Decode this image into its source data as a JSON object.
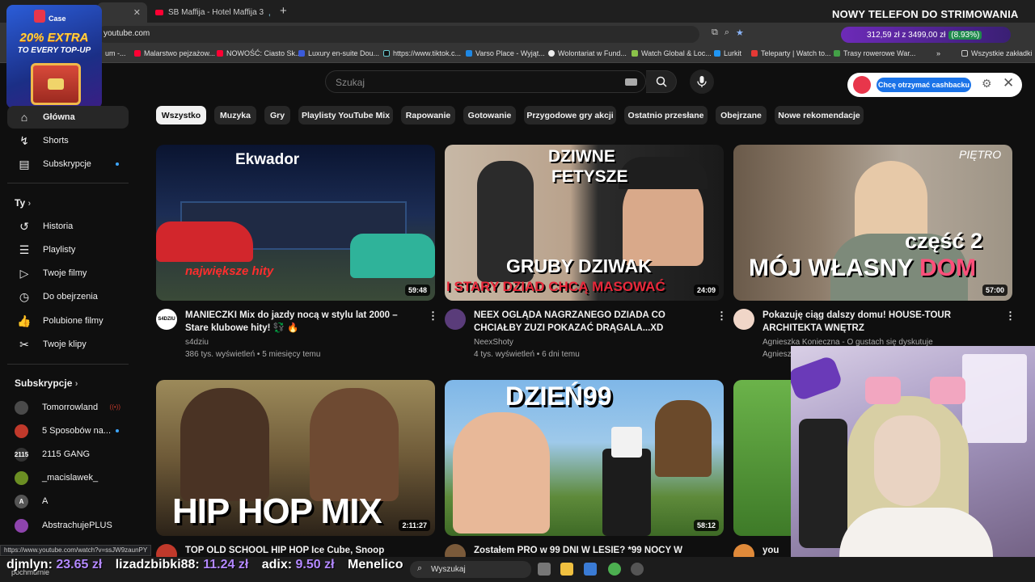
{
  "browser": {
    "tab_active_label": "",
    "tab_second_label": "SB Maffija - Hotel Maffija 3",
    "url": "youtube.com",
    "promo_heading": "NOWY TELEFON DO STRIMOWANIA",
    "wallet_text": "312,59 zł z 3499,00 zł",
    "wallet_pct": "(8.93%)",
    "bookmarks": [
      "um -...",
      "Malarstwo pejzażow...",
      "NOWOŚĆ: Ciasto Sk...",
      "Luxury en-suite Dou...",
      "https://www.tiktok.c...",
      "Varso Place - Wyjąt...",
      "Wolontariat w Fund...",
      "Watch Global & Loc...",
      "Lurkit",
      "Teleparty | Watch to...",
      "Trasy rowerowe War..."
    ],
    "bookmarks_all": "Wszystkie zakładki"
  },
  "casebox": {
    "logo": "Case",
    "extra": "20% EXTRA",
    "sub": "TO EVERY TOP-UP"
  },
  "youtube": {
    "search_placeholder": "Szukaj",
    "cashback_button": "Chcę otrzymać cashbacku",
    "sidebar": {
      "main": [
        {
          "label": "Główna",
          "icon": "home-icon"
        },
        {
          "label": "Shorts",
          "icon": "shorts-icon"
        },
        {
          "label": "Subskrypcje",
          "icon": "subscriptions-icon"
        }
      ],
      "you_heading": "Ty",
      "you_items": [
        {
          "label": "Historia",
          "icon": "history-icon"
        },
        {
          "label": "Playlisty",
          "icon": "playlists-icon"
        },
        {
          "label": "Twoje filmy",
          "icon": "your-videos-icon"
        },
        {
          "label": "Do obejrzenia",
          "icon": "watch-later-icon"
        },
        {
          "label": "Polubione filmy",
          "icon": "liked-icon"
        },
        {
          "label": "Twoje klipy",
          "icon": "clips-icon"
        }
      ],
      "subs_heading": "Subskrypcje",
      "subs": [
        {
          "label": "Tomorrowland",
          "avatar": "",
          "color": "#4a4a4a"
        },
        {
          "label": "5 Sposobów na...",
          "avatar": "",
          "color": "#c0392b"
        },
        {
          "label": "2115 GANG",
          "avatar": "2115",
          "color": "#333333"
        },
        {
          "label": "_macislawek_",
          "avatar": "",
          "color": "#6b8e23"
        },
        {
          "label": "A",
          "avatar": "A",
          "color": "#555555"
        },
        {
          "label": "AbstrachujePLUS",
          "avatar": "",
          "color": "#8e44ad"
        }
      ],
      "partial_label": "pochmurnie"
    },
    "chips": [
      "Wszystko",
      "Muzyka",
      "Gry",
      "Playlisty YouTube Mix",
      "Rapowanie",
      "Gotowanie",
      "Przygodowe gry akcji",
      "Ostatnio przesłane",
      "Obejrzane",
      "Nowe rekomendacje"
    ],
    "videos": [
      {
        "title": "MANIECZKI Mix do jazdy nocą w stylu lat 2000 – Stare klubowe hity! 💱 🔥",
        "channel": "s4dziu",
        "meta": "386 tys. wyświetleń • 5 miesięcy temu",
        "duration": "59:48",
        "overlay": "Ekwador",
        "overlay2": "największe hity",
        "avatar": "S4DZIU"
      },
      {
        "title": "NEEX OGLĄDA NAGRZANEGO DZIADA CO CHCIAŁBY ZUZI POKAZAĆ DRĄGALA...XD",
        "channel": "NeexShoty",
        "meta": "4 tys. wyświetleń • 6 dni temu",
        "duration": "24:09",
        "overlay": "DZIWNE",
        "overlay2": "FETYSZE",
        "overlay3": "GRUBY DZIWAK",
        "overlay4": "I STARY DZIAD CHCĄ MASOWAĆ"
      },
      {
        "title": "Pokazuję ciąg dalszy domu! HOUSE-TOUR ARCHITEKTA WNĘTRZ",
        "channel": "Agnieszka Konieczna - O gustach się dyskutuje",
        "meta": "Agnieszka Konieczna - O gustach się dyskutuje",
        "duration": "57:00",
        "overlay": "PIĘTRO",
        "overlay2": "część 2",
        "overlay3": "MÓJ WŁASNY",
        "overlay4": "DOM"
      },
      {
        "title": "TOP OLD SCHOOL HIP HOP Ice Cube, Snoop",
        "duration": "2:11:27",
        "overlay": "HIP HOP MIX"
      },
      {
        "title": "Zostałem PRO w 99 DNI W LESIE? *99 NOCY W LESIE*",
        "duration": "58:12",
        "overlay": "DZIEŃ99"
      },
      {
        "title": "you los"
      }
    ]
  },
  "bottom": {
    "status_url": "https://www.youtube.com/watch?v=ssJW9zaunPY",
    "tips": [
      {
        "name": "djmlyn:",
        "amount": "23.65 zł"
      },
      {
        "name": "lizadzbibki88:",
        "amount": "11.24 zł"
      },
      {
        "name": "adix:",
        "amount": "9.50 zł"
      },
      {
        "name": "Menelico",
        "amount": ""
      }
    ],
    "task_search": "Wyszukaj"
  }
}
